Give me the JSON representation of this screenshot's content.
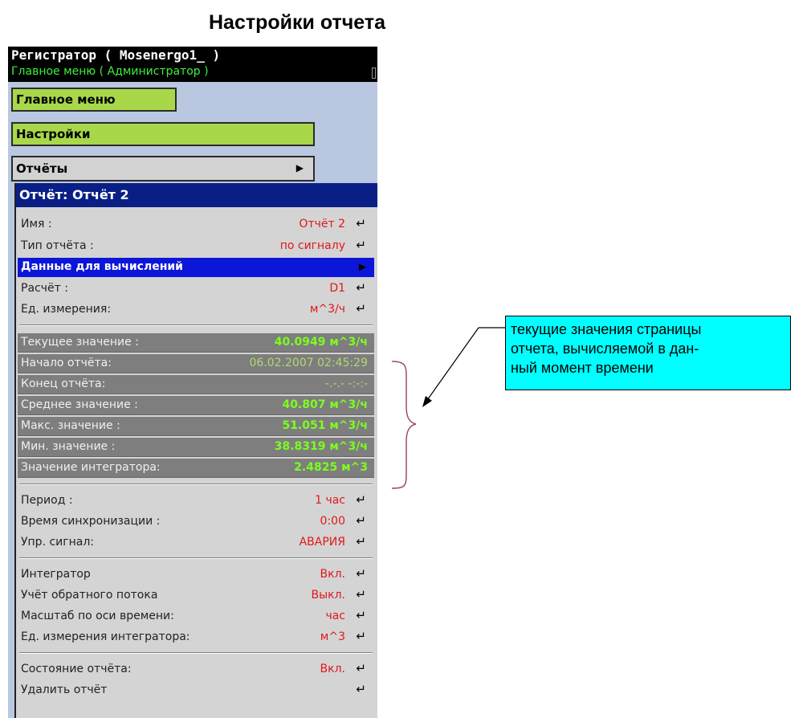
{
  "page_title": "Настройки отчета",
  "window": {
    "title": "Регистратор ( Mosenergo1_ )",
    "subtitle": "Главное меню ( Администратор )"
  },
  "menus": {
    "main": "Главное меню",
    "settings": "Настройки",
    "reports": "Отчёты"
  },
  "dialog": {
    "title": "Отчёт: Отчёт 2",
    "group1": [
      {
        "label": "Имя :",
        "value": "Отчёт 2"
      },
      {
        "label": "Тип отчёта :",
        "value": "по сигналу"
      },
      {
        "label": "Данные для вычислений",
        "value": ""
      },
      {
        "label": "Расчёт :",
        "value": "D1"
      },
      {
        "label": "Ед. измерения:",
        "value": "м^3/ч"
      }
    ],
    "current": [
      {
        "label": "Текущее значение :",
        "value": "40.0949 м^3/ч"
      },
      {
        "label": "Начало отчёта:",
        "value": "06.02.2007 02:45:29"
      },
      {
        "label": "Конец отчёта:",
        "value": "-.-.- -:-:-"
      },
      {
        "label": "Среднее значение :",
        "value": "40.807 м^3/ч"
      },
      {
        "label": "Макс. значение :",
        "value": "51.051 м^3/ч"
      },
      {
        "label": "Мин. значение :",
        "value": "38.8319 м^3/ч"
      },
      {
        "label": "Значение интегратора:",
        "value": "2.4825 м^3"
      }
    ],
    "group2": [
      {
        "label": "Период :",
        "value": "1 час"
      },
      {
        "label": "Время синхронизации :",
        "value": "0:00"
      },
      {
        "label": "Упр. сигнал:",
        "value": "АВАРИЯ"
      }
    ],
    "group3": [
      {
        "label": "Интегратор",
        "value": "Вкл."
      },
      {
        "label": "Учёт обратного потока",
        "value": "Выкл."
      },
      {
        "label": "Масштаб по оси времени:",
        "value": "час"
      },
      {
        "label": "Ед. измерения интегратора:",
        "value": "м^3"
      }
    ],
    "group4": [
      {
        "label": "Состояние отчёта:",
        "value": "Вкл."
      },
      {
        "label": "Удалить отчёт",
        "value": ""
      }
    ]
  },
  "callout": {
    "lines": [
      "текущие значения страницы",
      "отчета, вычисляемой в дан-",
      "ный момент времени"
    ]
  },
  "icons": {
    "enter": "enter-arrow-icon",
    "submenu": "submenu-arrow-icon"
  }
}
